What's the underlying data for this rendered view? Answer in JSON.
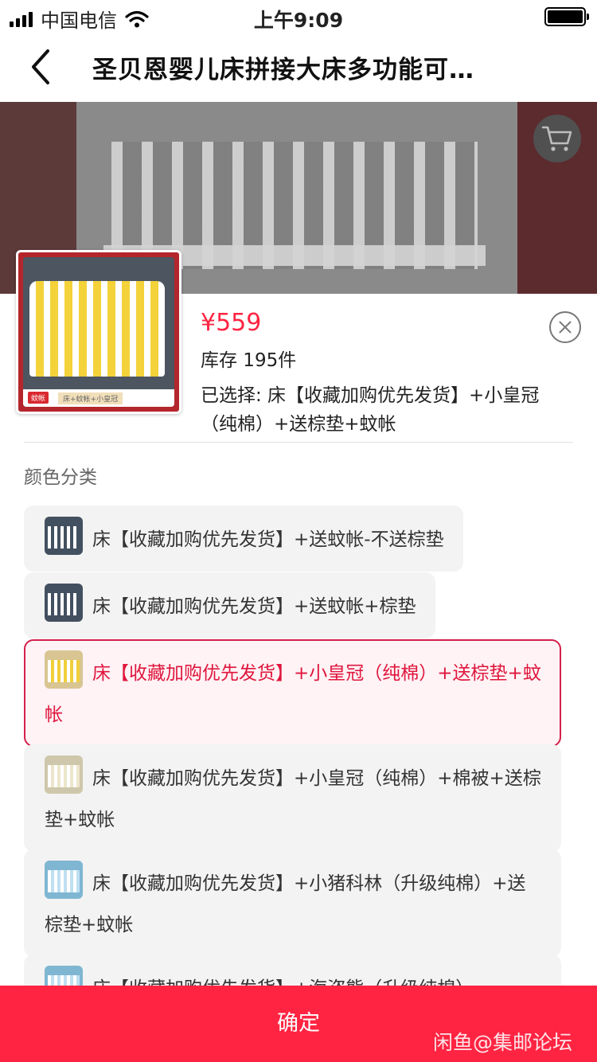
{
  "status_bar": {
    "carrier": "中国电信",
    "time": "上午9:09"
  },
  "nav": {
    "title": "圣贝恩婴儿床拼接大床多功能可…"
  },
  "product": {
    "price": "¥559",
    "stock": "库存 195件",
    "selected": "已选择: 床【收藏加购优先发货】+小皇冠（纯棉）+送棕垫+蚊帐",
    "thumb_tag": "蚊帐",
    "thumb_caption": "床+蚊帐+小皇冠"
  },
  "section": {
    "title": "颜色分类"
  },
  "options": [
    {
      "label": "床【收藏加购优先发货】+送蚊帐-不送棕垫",
      "selected": false
    },
    {
      "label": "床【收藏加购优先发货】+送蚊帐+棕垫",
      "selected": false
    },
    {
      "label": "床【收藏加购优先发货】+小皇冠（纯棉）+送棕垫+蚊帐",
      "selected": true
    },
    {
      "label": "床【收藏加购优先发货】+小皇冠（纯棉）+棉被+送棕垫+蚊帐",
      "selected": false
    },
    {
      "label": "床【收藏加购优先发货】+小猪科林（升级纯棉）+送棕垫+蚊帐",
      "selected": false
    },
    {
      "label": "床【收藏加购优先发货】+海盗熊（升级纯棉）",
      "selected": false
    }
  ],
  "confirm_label": "确定",
  "watermark": "闲鱼@集邮论坛",
  "colors": {
    "accent": "#ff2442",
    "selected_border": "#d3204a"
  },
  "icons": [
    "signal-icon",
    "wifi-icon",
    "battery-icon",
    "back-arrow-icon",
    "cart-icon",
    "close-icon"
  ]
}
